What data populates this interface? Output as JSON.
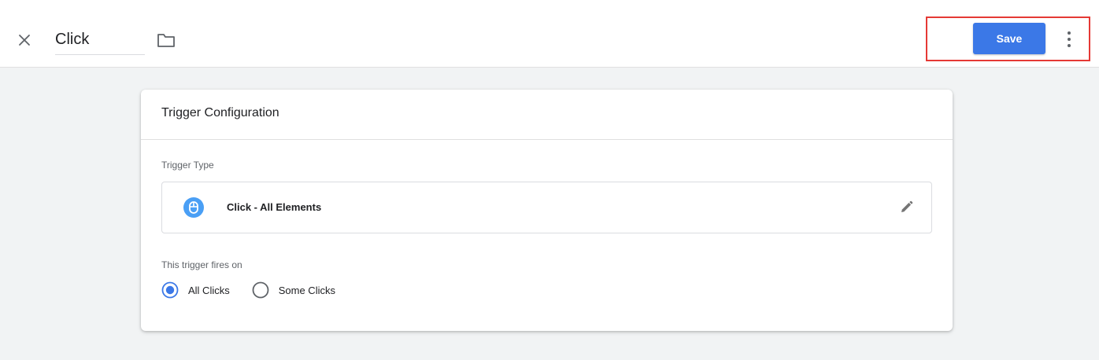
{
  "header": {
    "trigger_name": "Click",
    "save_label": "Save"
  },
  "card": {
    "title": "Trigger Configuration",
    "trigger_type_label": "Trigger Type",
    "trigger_type": {
      "name": "Click - All Elements",
      "icon": "mouse-icon"
    },
    "fires_on_label": "This trigger fires on",
    "fires_on_options": [
      {
        "label": "All Clicks",
        "selected": true
      },
      {
        "label": "Some Clicks",
        "selected": false
      }
    ]
  },
  "colors": {
    "accent": "#3b78e7",
    "highlight": "#e53935",
    "icon_blue": "#4a9ff5",
    "background": "#f1f3f4"
  }
}
